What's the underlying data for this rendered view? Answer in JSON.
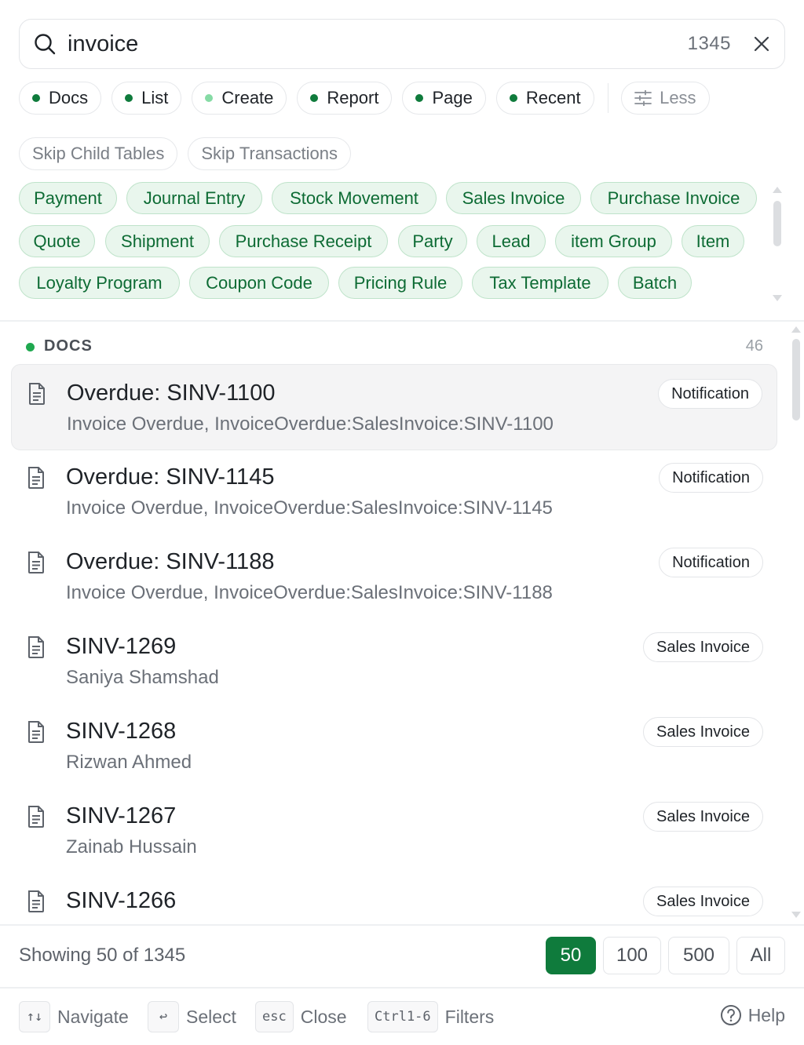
{
  "search": {
    "value": "invoice",
    "count": "1345"
  },
  "filters": [
    {
      "label": "Docs",
      "dot": "dark"
    },
    {
      "label": "List",
      "dot": "dark"
    },
    {
      "label": "Create",
      "dot": "light"
    },
    {
      "label": "Report",
      "dot": "dark"
    },
    {
      "label": "Page",
      "dot": "dark"
    },
    {
      "label": "Recent",
      "dot": "dark"
    }
  ],
  "less_label": "Less",
  "skip": {
    "child_tables": "Skip Child Tables",
    "transactions": "Skip Transactions"
  },
  "doctypes": [
    "Payment",
    "Journal Entry",
    "Stock Movement",
    "Sales Invoice",
    "Purchase Invoice",
    "Quote",
    "Shipment",
    "Purchase Receipt",
    "Party",
    "Lead",
    "item Group",
    "Item",
    "Loyalty Program",
    "Coupon Code",
    "Pricing Rule",
    "Tax Template",
    "Batch"
  ],
  "section": {
    "title": "DOCS",
    "count": "46"
  },
  "results": [
    {
      "title": "Overdue: SINV-1100",
      "subtitle": "Invoice Overdue, InvoiceOverdue:SalesInvoice:SINV-1100",
      "tag": "Notification"
    },
    {
      "title": "Overdue: SINV-1145",
      "subtitle": "Invoice Overdue, InvoiceOverdue:SalesInvoice:SINV-1145",
      "tag": "Notification"
    },
    {
      "title": "Overdue: SINV-1188",
      "subtitle": "Invoice Overdue, InvoiceOverdue:SalesInvoice:SINV-1188",
      "tag": "Notification"
    },
    {
      "title": "SINV-1269",
      "subtitle": "Saniya Shamshad",
      "tag": "Sales Invoice"
    },
    {
      "title": "SINV-1268",
      "subtitle": "Rizwan Ahmed",
      "tag": "Sales Invoice"
    },
    {
      "title": "SINV-1267",
      "subtitle": "Zainab Hussain",
      "tag": "Sales Invoice"
    },
    {
      "title": "SINV-1266",
      "subtitle": "",
      "tag": "Sales Invoice"
    }
  ],
  "footer": {
    "showing": "Showing 50 of 1345",
    "page_sizes": [
      "50",
      "100",
      "500",
      "All"
    ],
    "shortcuts": [
      {
        "key": "↑↓",
        "label": "Navigate"
      },
      {
        "key": "↩",
        "label": "Select"
      },
      {
        "key": "esc",
        "label": "Close"
      },
      {
        "key": "Ctrl1-6",
        "label": "Filters"
      }
    ],
    "help": "Help"
  },
  "colors": {
    "accent": "#0f7b3c",
    "chip_bg": "#e9f6ed",
    "chip_text": "#0d6b34"
  }
}
